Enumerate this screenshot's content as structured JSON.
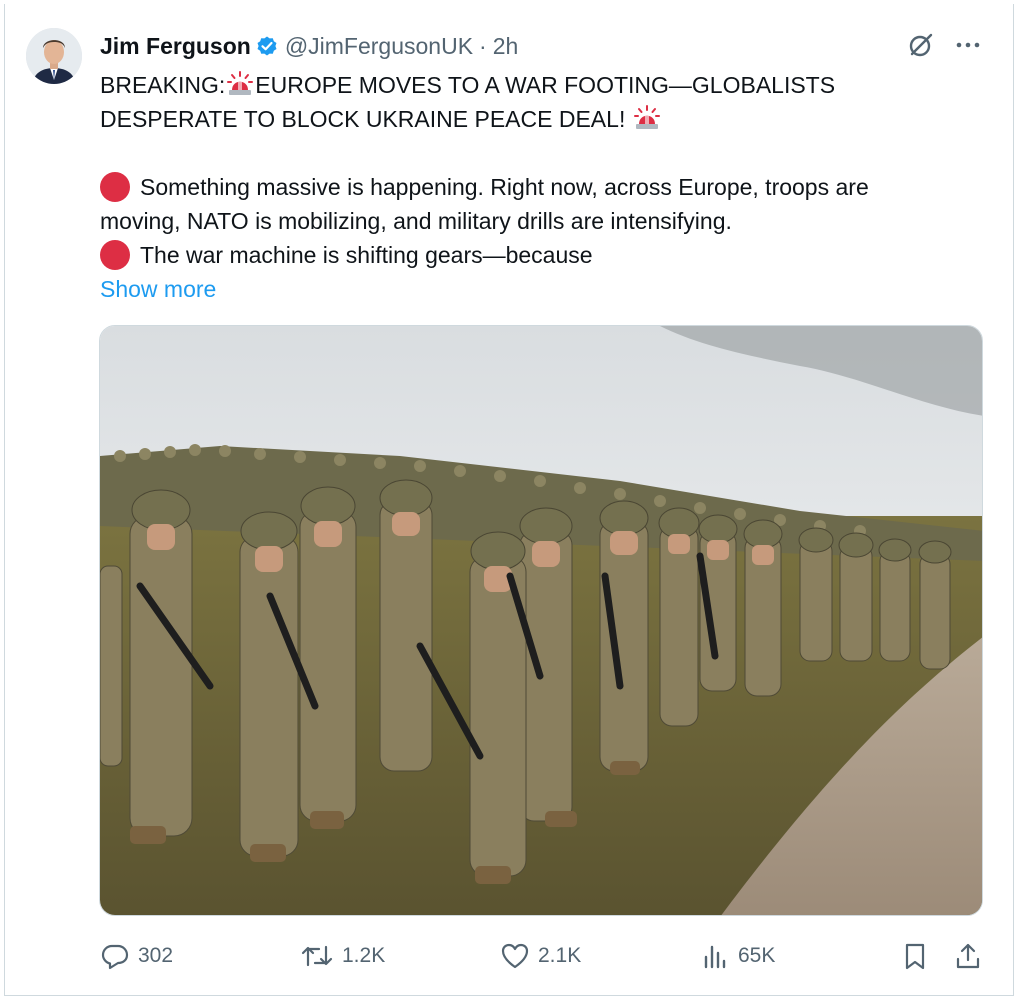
{
  "tweet": {
    "author_name": "Jim Ferguson",
    "handle": "@JimFergusonUK",
    "separator": "·",
    "time": "2h",
    "lines": {
      "l1_prefix": "BREAKING:",
      "l1_suffix": "EUROPE MOVES TO A WAR FOOTING—GLOBALISTS",
      "l2": "DESPERATE TO BLOCK UKRAINE PEACE DEAL!",
      "l3": "Something massive is happening. Right now, across Europe, troops are",
      "l4": "moving, NATO is mobilizing, and military drills are intensifying.",
      "l5": "The war machine is shifting gears—because"
    },
    "show_more": "Show more"
  },
  "icons": {
    "verified": "verified-badge-icon",
    "grok": "grok-icon",
    "more": "more-icon",
    "siren": "police-light-emoji",
    "red_circle": "red-circle-emoji"
  },
  "media": {
    "description_icon": "photo"
  },
  "actions": {
    "replies": "302",
    "reposts": "1.2K",
    "likes": "2.1K",
    "views": "65K"
  },
  "colors": {
    "link": "#1d9bf0",
    "secondary_text": "#536471",
    "verified": "#1d9bf0",
    "red_circle": "#dd2e44"
  }
}
